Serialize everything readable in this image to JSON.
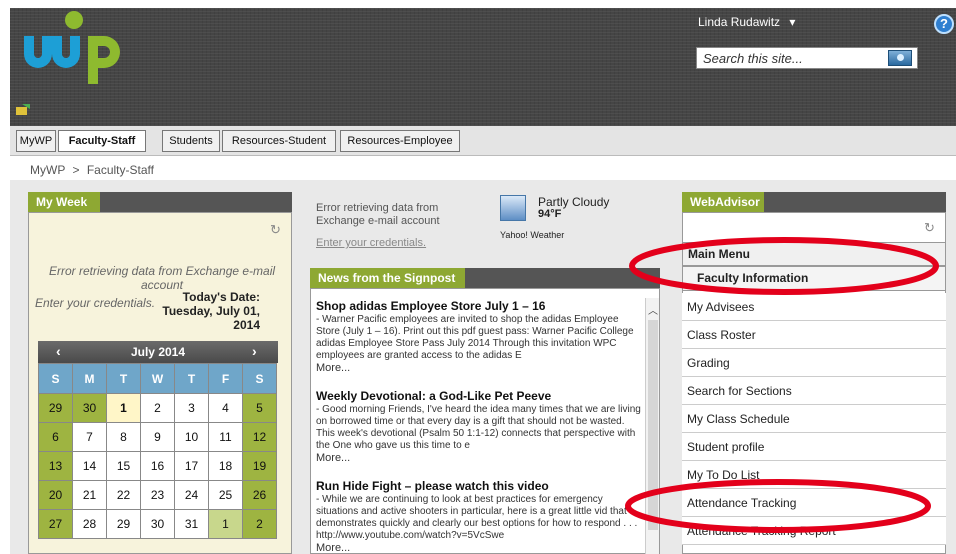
{
  "header": {
    "user_name": "Linda Rudawitz",
    "user_caret": "▾",
    "help_label": "?",
    "search_placeholder": "Search this site..."
  },
  "tabs": [
    {
      "label": "MyWP"
    },
    {
      "label": "Faculty-Staff"
    },
    {
      "label": "Students"
    },
    {
      "label": "Resources-Student"
    },
    {
      "label": "Resources-Employee"
    }
  ],
  "breadcrumb": {
    "root": "MyWP",
    "sep": ">",
    "current": "Faculty-Staff"
  },
  "my_week": {
    "title": "My Week",
    "error": "Error retrieving data from Exchange e-mail account",
    "credentials": "Enter your credentials.",
    "date_label": "Today's Date:",
    "date_value": "Tuesday, July 01, 2014",
    "calendar": {
      "month": "July 2014",
      "prev": "‹",
      "next": "›",
      "weekdays": [
        "S",
        "M",
        "T",
        "W",
        "T",
        "F",
        "S"
      ],
      "weeks": [
        [
          "29",
          "30",
          "1",
          "2",
          "3",
          "4",
          "5"
        ],
        [
          "6",
          "7",
          "8",
          "9",
          "10",
          "11",
          "12"
        ],
        [
          "13",
          "14",
          "15",
          "16",
          "17",
          "18",
          "19"
        ],
        [
          "20",
          "21",
          "22",
          "23",
          "24",
          "25",
          "26"
        ],
        [
          "27",
          "28",
          "29",
          "30",
          "31",
          "1",
          "2"
        ]
      ]
    }
  },
  "weather": {
    "error": "Error retrieving data from Exchange e-mail account",
    "credentials": "Enter your credentials.",
    "condition": "Partly Cloudy",
    "temperature": "94°F",
    "source": "Yahoo! Weather"
  },
  "news": {
    "title": "News from the Signpost",
    "items": [
      {
        "title": "Shop adidas Employee Store July 1 – 16",
        "body": "- Warner Pacific employees are invited to shop the adidas Employee Store (July 1 – 16).  Print out this pdf guest pass: Warner Pacific College adidas Employee Store Pass July 2014 Through this invitation WPC employees are granted access to the adidas E",
        "more": "More..."
      },
      {
        "title": "Weekly Devotional: a God-Like Pet Peeve",
        "body": "- Good morning Friends, I've heard the idea many times that we are living on borrowed time or that every day is a gift that should not be wasted. This week's devotional (Psalm 50 1:1-12) connects that perspective with the One who gave us this time to e",
        "more": "More..."
      },
      {
        "title": "Run Hide Fight – please watch this video",
        "body": "- While we are continuing to look at best practices for emergency situations and active shooters in particular, here is a great little vid that demonstrates quickly and clearly our best options for how to respond . . . http://www.youtube.com/watch?v=5VcSwe",
        "more": "More..."
      }
    ]
  },
  "webadvisor": {
    "title": "WebAdvisor",
    "main_menu": "Main Menu",
    "faculty_info": "Faculty Information",
    "items": [
      "My Advisees",
      "Class Roster",
      "Grading",
      "Search for Sections",
      "My Class Schedule",
      "Student profile",
      "My To Do List",
      "Attendance Tracking",
      "Attendance Tracking Report"
    ]
  },
  "colors": {
    "accent_green": "#8ea833",
    "header_dark": "#454545",
    "annotation_red": "#e3001b"
  }
}
